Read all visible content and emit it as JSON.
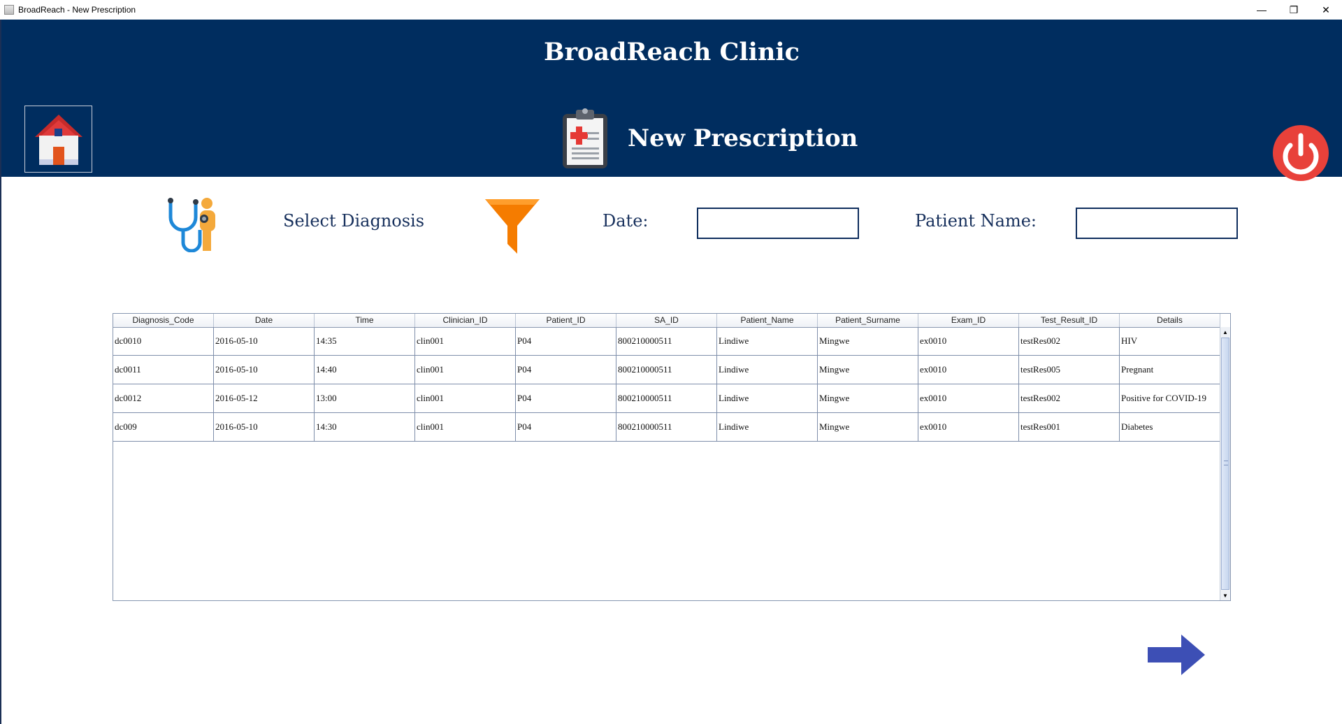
{
  "window": {
    "title": "BroadReach - New Prescription",
    "controls": {
      "minimize": "—",
      "restore": "❐",
      "close": "✕"
    }
  },
  "header": {
    "clinic_name": "BroadReach Clinic",
    "page_title": "New Prescription",
    "home_icon": "home-icon",
    "clipboard_icon": "medical-clipboard-icon",
    "power_icon": "power-icon",
    "colors": {
      "header_bg": "#002d5f",
      "power_red": "#e8413a"
    }
  },
  "filters": {
    "select_diagnosis_label": "Select Diagnosis",
    "date_label": "Date:",
    "date_value": "",
    "patient_name_label": "Patient Name:",
    "patient_name_value": "",
    "funnel_icon": "filter-funnel-icon",
    "doctor_icon": "doctor-stethoscope-icon"
  },
  "table": {
    "columns": [
      "Diagnosis_Code",
      "Date",
      "Time",
      "Clinician_ID",
      "Patient_ID",
      "SA_ID",
      "Patient_Name",
      "Patient_Surname",
      "Exam_ID",
      "Test_Result_ID",
      "Details"
    ],
    "rows": [
      [
        "dc0010",
        "2016-05-10",
        "14:35",
        "clin001",
        "P04",
        "800210000511",
        "Lindiwe",
        "Mingwe",
        "ex0010",
        "testRes002",
        "HIV"
      ],
      [
        "dc0011",
        "2016-05-10",
        "14:40",
        "clin001",
        "P04",
        "800210000511",
        "Lindiwe",
        "Mingwe",
        "ex0010",
        "testRes005",
        "Pregnant"
      ],
      [
        "dc0012",
        "2016-05-12",
        "13:00",
        "clin001",
        "P04",
        "800210000511",
        "Lindiwe",
        "Mingwe",
        "ex0010",
        "testRes002",
        "Positive for COVID-19"
      ],
      [
        "dc009",
        "2016-05-10",
        "14:30",
        "clin001",
        "P04",
        "800210000511",
        "Lindiwe",
        "Mingwe",
        "ex0010",
        "testRes001",
        "Diabetes"
      ]
    ]
  },
  "next_button": {
    "icon": "right-arrow-icon",
    "color": "#3d4fb5"
  }
}
